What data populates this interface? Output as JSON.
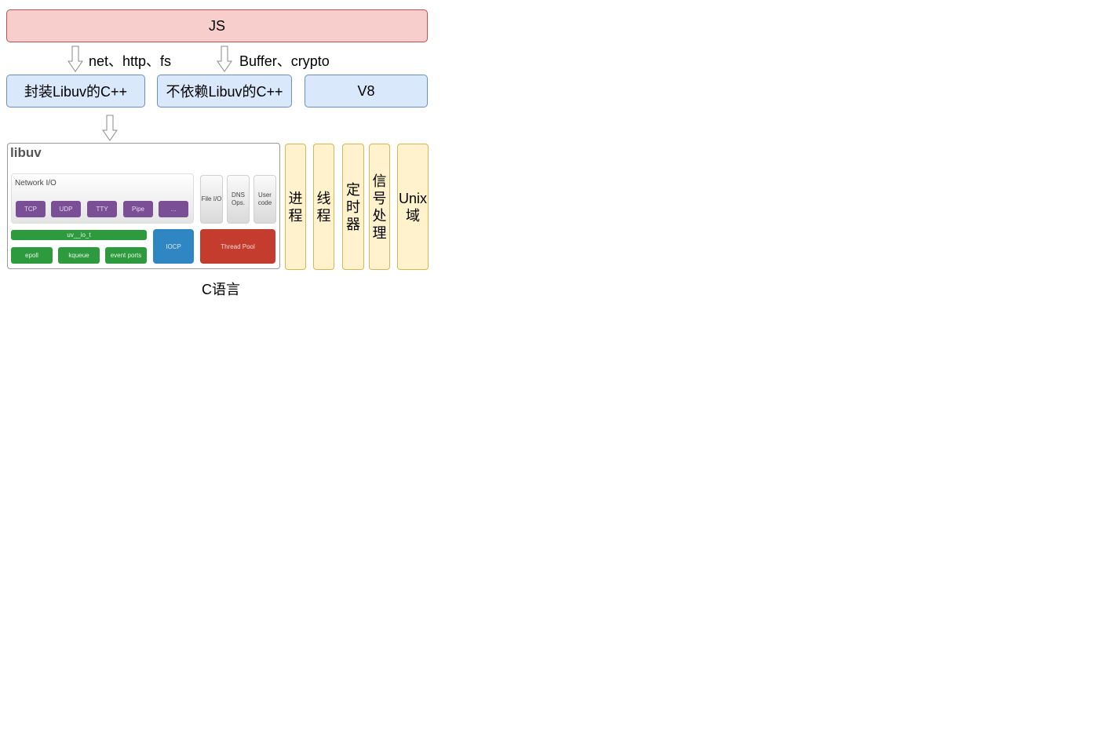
{
  "top": {
    "js_label": "JS"
  },
  "edges": {
    "label_left": "net、http、fs",
    "label_right": "Buffer、crypto"
  },
  "cpp_layer": {
    "wrap_libuv": "封装Libuv的C++",
    "no_libuv": "不依赖Libuv的C++",
    "v8": "V8"
  },
  "libuv": {
    "title": "libuv",
    "network_title": "Network I/O",
    "network_items": [
      "TCP",
      "UDP",
      "TTY",
      "Pipe",
      "..."
    ],
    "file_io": "File I/O",
    "dns_ops": "DNS Ops.",
    "user_code": "User code",
    "uv_io_t": "uv__io_t",
    "backends": [
      "epoll",
      "kqueue",
      "event ports"
    ],
    "iocp": "IOCP",
    "thread_pool": "Thread Pool"
  },
  "os_features": [
    "进程",
    "线程",
    "定时器",
    "信号处理",
    "Unix域"
  ],
  "caption": "C语言",
  "colors": {
    "js_fill": "#f8cecc",
    "js_stroke": "#b85450",
    "cpp_fill": "#dae8fc",
    "cpp_stroke": "#6c8ebf",
    "os_fill": "#fff2cc",
    "os_stroke": "#d6b656",
    "network_item": "#7a4f96",
    "backend": "#2e9a3e",
    "iocp": "#2f86c2",
    "thread_pool": "#c43c2e"
  },
  "icons": {
    "arrow": "arrow-down-hollow-icon"
  }
}
